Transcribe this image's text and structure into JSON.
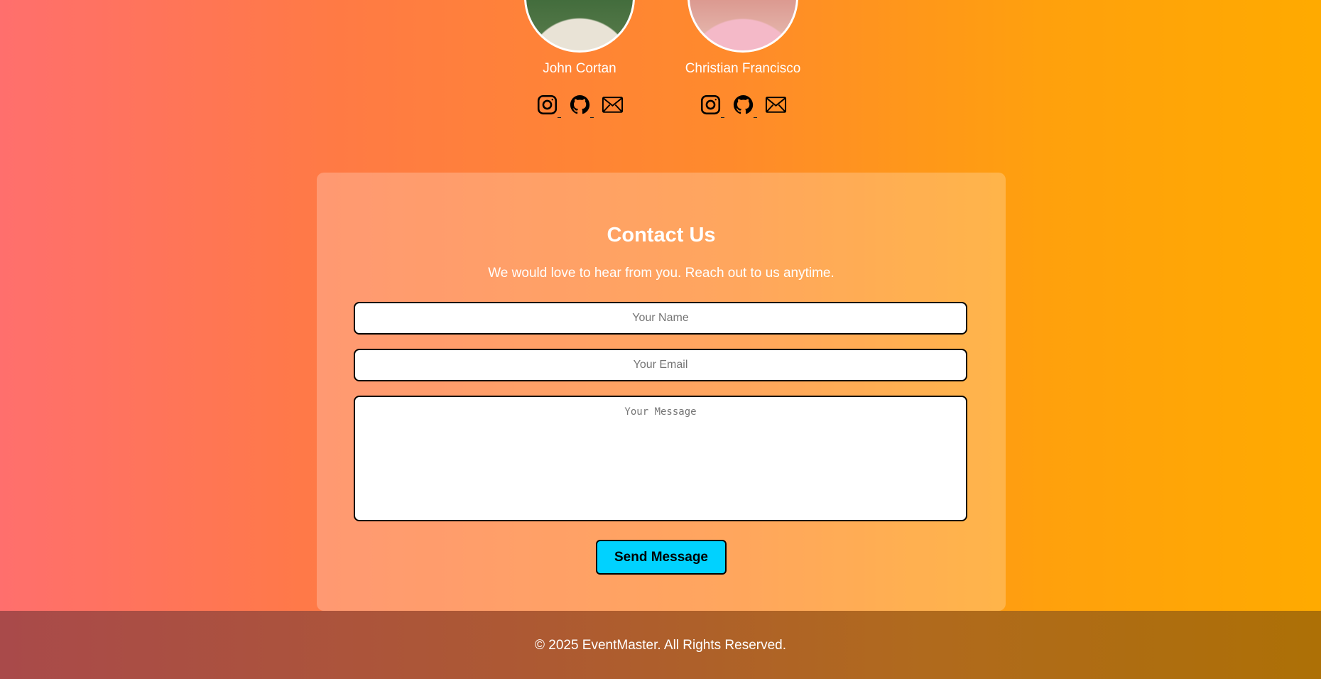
{
  "team": {
    "members": [
      {
        "name": "John Cortan",
        "socials": [
          "instagram-icon",
          "github-icon",
          "mail-icon"
        ]
      },
      {
        "name": "Christian Francisco",
        "socials": [
          "instagram-icon",
          "github-icon",
          "mail-icon"
        ]
      }
    ]
  },
  "contact": {
    "title": "Contact Us",
    "subtitle": "We would love to hear from you. Reach out to us anytime.",
    "name_placeholder": "Your Name",
    "email_placeholder": "Your Email",
    "message_placeholder": "Your Message",
    "send_label": "Send Message",
    "button_color": "#00d2ff"
  },
  "footer": {
    "text": "© 2025 EventMaster. All Rights Reserved."
  }
}
